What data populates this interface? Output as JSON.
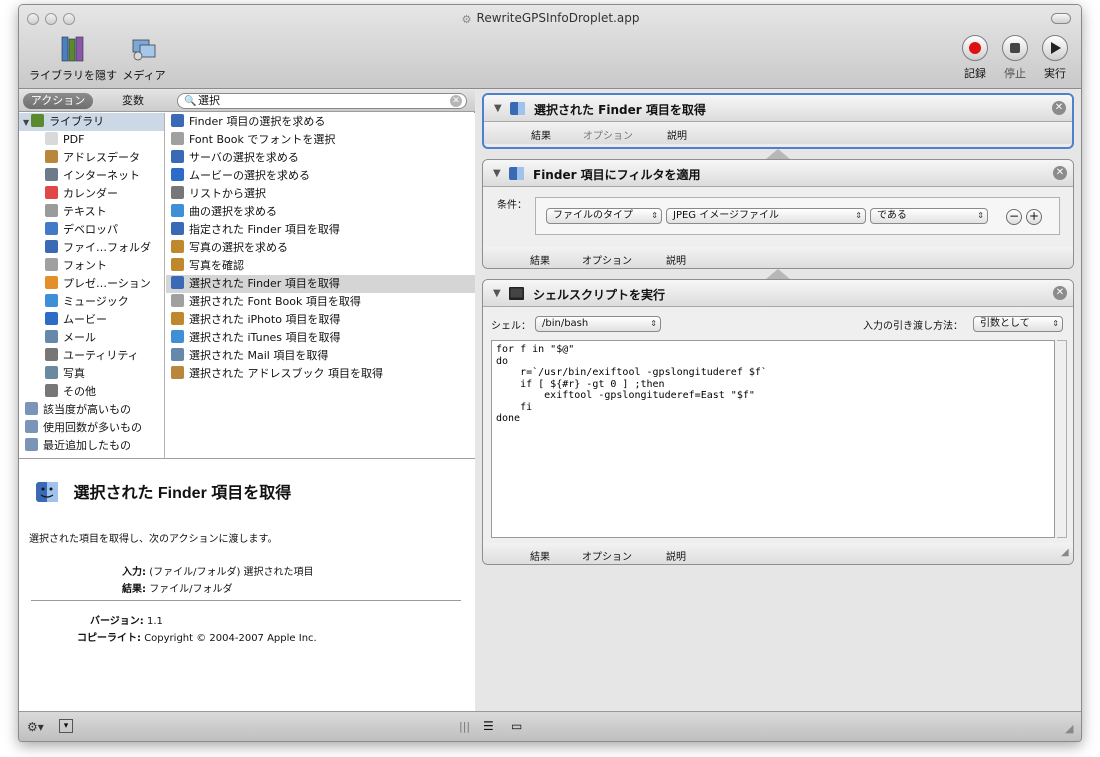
{
  "window": {
    "title": "RewriteGPSInfoDroplet.app"
  },
  "toolbar": {
    "hide_library_label": "ライブラリを隠す",
    "media_label": "メディア",
    "record_label": "記録",
    "stop_label": "停止",
    "run_label": "実行"
  },
  "left_tabs": {
    "action": "アクション",
    "variables": "変数"
  },
  "search": {
    "value": "選択"
  },
  "library": {
    "items": [
      {
        "label": "ライブラリ",
        "icon": "library-icon",
        "color": "#5b8a2e"
      },
      {
        "label": "PDF",
        "icon": "pdf-icon",
        "color": "#d9d9d9"
      },
      {
        "label": "アドレスデータ",
        "icon": "addressbook-icon",
        "color": "#b9863b"
      },
      {
        "label": "インターネット",
        "icon": "internet-icon",
        "color": "#6c7a8a"
      },
      {
        "label": "カレンダー",
        "icon": "calendar-icon",
        "color": "#e04848"
      },
      {
        "label": "テキスト",
        "icon": "text-icon",
        "color": "#9b9b9b"
      },
      {
        "label": "デベロッパ",
        "icon": "developer-icon",
        "color": "#4479c8"
      },
      {
        "label": "ファイ…フォルダ",
        "icon": "finder-icon",
        "color": "#3a69b6"
      },
      {
        "label": "フォント",
        "icon": "font-icon",
        "color": "#a0a0a0"
      },
      {
        "label": "プレゼ…ーション",
        "icon": "presentation-icon",
        "color": "#e3902a"
      },
      {
        "label": "ミュージック",
        "icon": "music-icon",
        "color": "#3f8fd6"
      },
      {
        "label": "ムービー",
        "icon": "movie-icon",
        "color": "#2c6cc6"
      },
      {
        "label": "メール",
        "icon": "mail-icon",
        "color": "#6688aa"
      },
      {
        "label": "ユーティリティ",
        "icon": "utility-icon",
        "color": "#777777"
      },
      {
        "label": "写真",
        "icon": "photo-icon",
        "color": "#6a8aa0"
      },
      {
        "label": "その他",
        "icon": "other-icon",
        "color": "#777777"
      },
      {
        "label": "該当度が高いもの",
        "icon": "smart-folder-icon",
        "color": "#7b95b8"
      },
      {
        "label": "使用回数が多いもの",
        "icon": "smart-folder-icon",
        "color": "#7b95b8"
      },
      {
        "label": "最近追加したもの",
        "icon": "smart-folder-icon",
        "color": "#7b95b8"
      }
    ]
  },
  "actions": {
    "items": [
      {
        "label": "Finder 項目の選択を求める",
        "icon": "finder-icon",
        "color": "#3a69b6"
      },
      {
        "label": "Font Book でフォントを選択",
        "icon": "font-icon",
        "color": "#a0a0a0"
      },
      {
        "label": "サーバの選択を求める",
        "icon": "finder-icon",
        "color": "#3a69b6"
      },
      {
        "label": "ムービーの選択を求める",
        "icon": "movie-icon",
        "color": "#2c6cc6"
      },
      {
        "label": "リストから選択",
        "icon": "utility-icon",
        "color": "#777777"
      },
      {
        "label": "曲の選択を求める",
        "icon": "music-icon",
        "color": "#3f8fd6"
      },
      {
        "label": "指定された Finder 項目を取得",
        "icon": "finder-icon",
        "color": "#3a69b6"
      },
      {
        "label": "写真の選択を求める",
        "icon": "iphoto-icon",
        "color": "#c0882c"
      },
      {
        "label": "写真を確認",
        "icon": "iphoto-icon",
        "color": "#c0882c"
      },
      {
        "label": "選択された Finder 項目を取得",
        "icon": "finder-icon",
        "color": "#3a69b6"
      },
      {
        "label": "選択された Font Book 項目を取得",
        "icon": "font-icon",
        "color": "#a0a0a0"
      },
      {
        "label": "選択された iPhoto 項目を取得",
        "icon": "iphoto-icon",
        "color": "#c0882c"
      },
      {
        "label": "選択された iTunes 項目を取得",
        "icon": "music-icon",
        "color": "#3f8fd6"
      },
      {
        "label": "選択された Mail 項目を取得",
        "icon": "mail-icon",
        "color": "#6688aa"
      },
      {
        "label": "選択された アドレスブック 項目を取得",
        "icon": "addressbook-icon",
        "color": "#b9863b"
      }
    ]
  },
  "description": {
    "title": "選択された Finder 項目を取得",
    "text": "選択された項目を取得し、次のアクションに渡します。",
    "input_key": "入力:",
    "input_value": "(ファイル/フォルダ) 選択された項目",
    "result_key": "結果:",
    "result_value": "ファイル/フォルダ",
    "version_key": "バージョン:",
    "version_value": "1.1",
    "copyright_key": "コピーライト:",
    "copyright_value": "Copyright © 2004-2007 Apple Inc."
  },
  "workflow": {
    "footer_result": "結果",
    "footer_options": "オプション",
    "footer_description": "説明",
    "card1": {
      "title": "選択された Finder 項目を取得"
    },
    "card2": {
      "title": "Finder 項目にフィルタを適用",
      "condition_label": "条件：",
      "filter_attr": "ファイルのタイプ",
      "filter_value": "JPEG イメージファイル",
      "filter_op": "である"
    },
    "card3": {
      "title": "シェルスクリプトを実行",
      "shell_label": "シェル：",
      "shell_value": "/bin/bash",
      "input_method_label": "入力の引き渡し方法：",
      "input_method_value": "引数として",
      "script": "for f in \"$@\"\ndo\n    r=`/usr/bin/exiftool -gpslongituderef $f`\n    if [ ${#r} -gt 0 ] ;then\n        exiftool -gpslongituderef=East \"$f\"\n    fi\ndone"
    }
  }
}
